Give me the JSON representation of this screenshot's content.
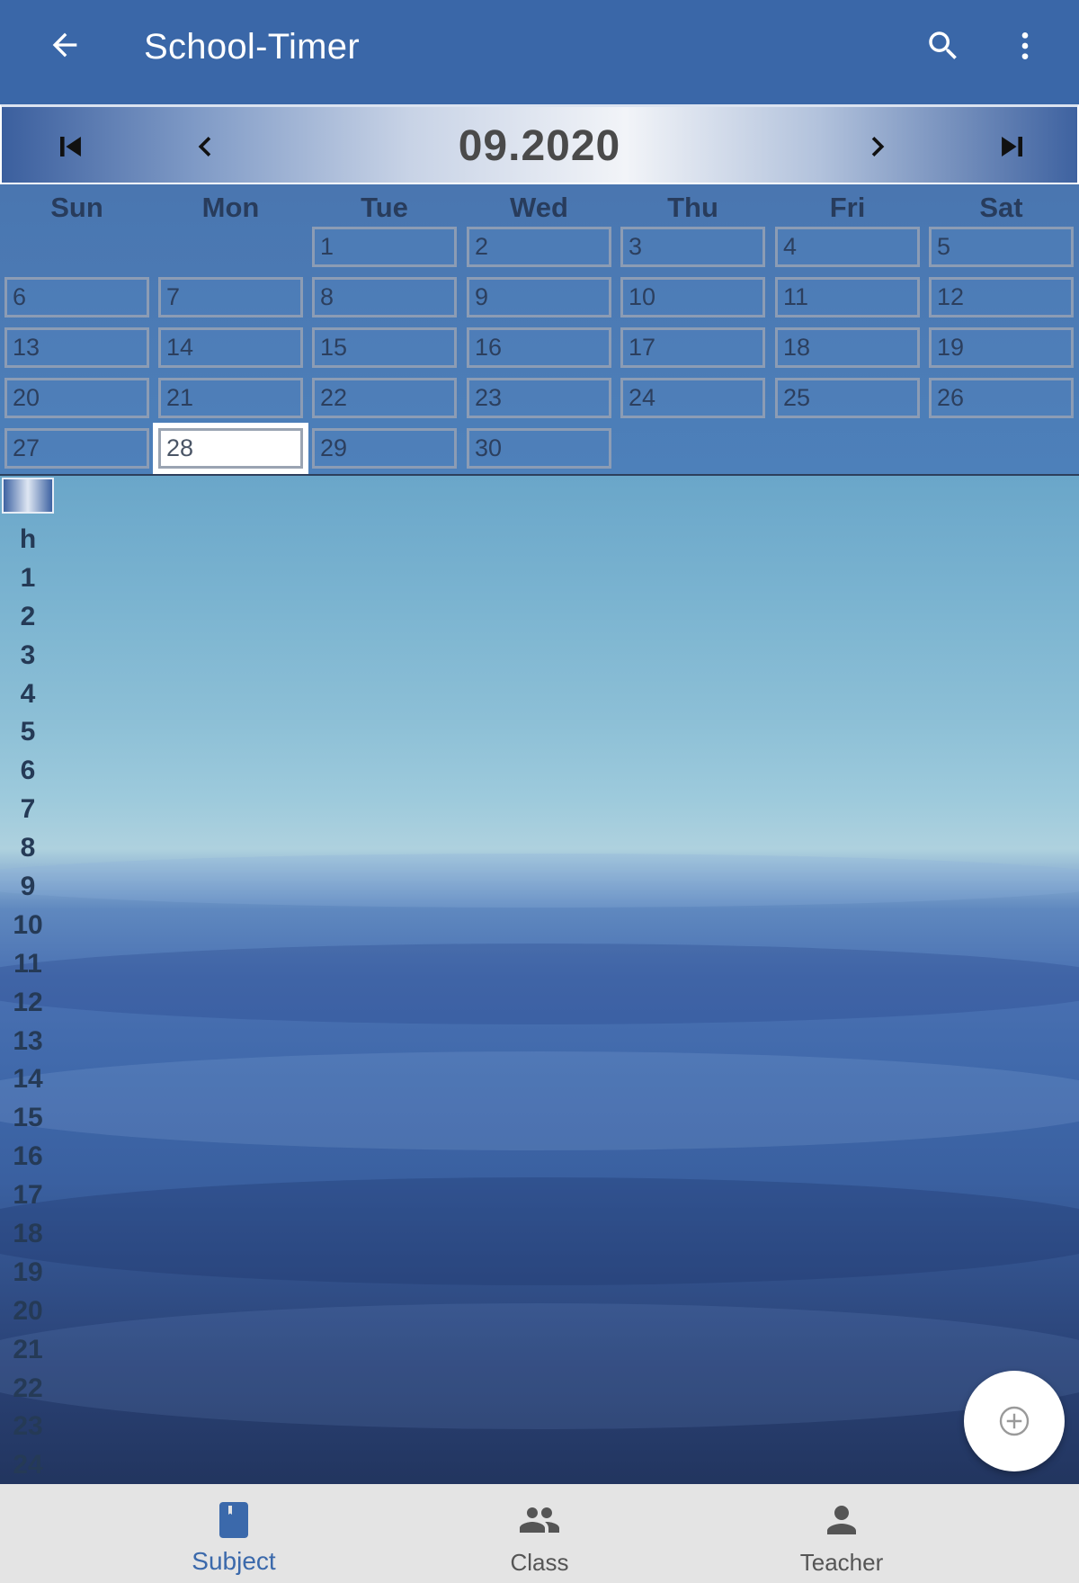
{
  "appbar": {
    "title": "School-Timer"
  },
  "month_nav": {
    "month": "09.2020"
  },
  "calendar": {
    "weekdays": [
      "Sun",
      "Mon",
      "Tue",
      "Wed",
      "Thu",
      "Fri",
      "Sat"
    ],
    "days": [
      "1",
      "2",
      "3",
      "4",
      "5",
      "6",
      "7",
      "8",
      "9",
      "10",
      "11",
      "12",
      "13",
      "14",
      "15",
      "16",
      "17",
      "18",
      "19",
      "20",
      "21",
      "22",
      "23",
      "24",
      "25",
      "26",
      "27",
      "28",
      "29",
      "30"
    ],
    "selected_day": "28"
  },
  "schedule": {
    "header": "h",
    "hours": [
      "1",
      "2",
      "3",
      "4",
      "5",
      "6",
      "7",
      "8",
      "9",
      "10",
      "11",
      "12",
      "13",
      "14",
      "15",
      "16",
      "17",
      "18",
      "19",
      "20",
      "21",
      "22",
      "23",
      "24"
    ]
  },
  "bottom_nav": {
    "subject": "Subject",
    "class": "Class",
    "teacher": "Teacher",
    "active": "Subject"
  },
  "colors": {
    "primary": "#3a67a8",
    "bottom_bar": "#e4e4e4",
    "active_tab": "#3b69ab",
    "inactive_tab": "#555555"
  },
  "icons": {
    "back": "arrow-left-icon",
    "search": "search-icon",
    "more": "more-vert-icon",
    "first": "skip-first-icon",
    "prev": "chevron-left-icon",
    "next": "chevron-right-icon",
    "last": "skip-last-icon",
    "fab": "add-circle-icon",
    "subject": "book-icon",
    "class": "group-icon",
    "teacher": "person-icon"
  }
}
